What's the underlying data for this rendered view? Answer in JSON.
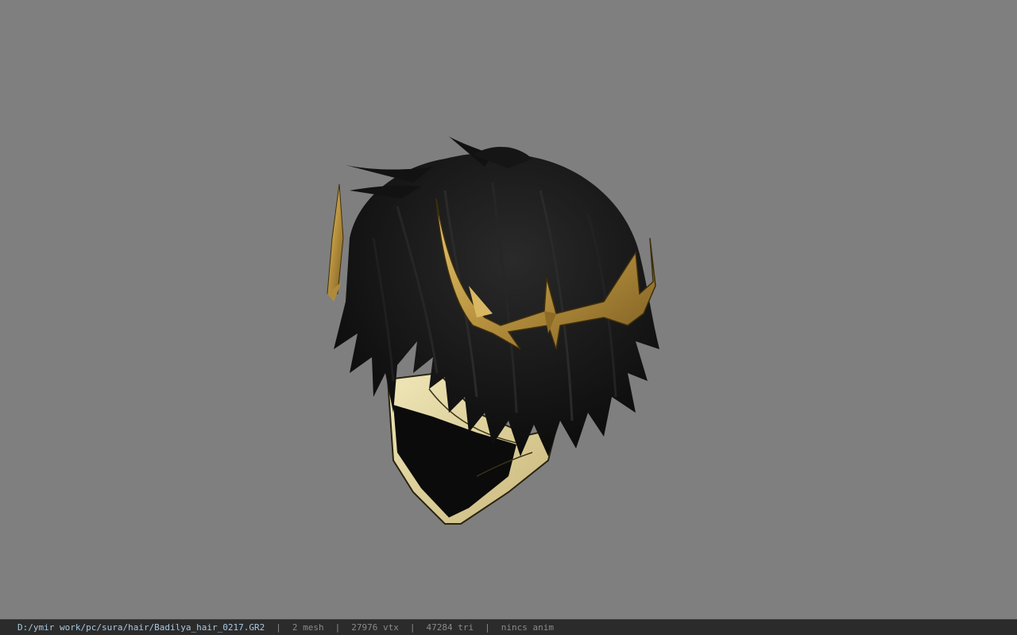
{
  "viewport": {
    "background": "#7f7f7f",
    "model_name": "hair-model-preview"
  },
  "status_bar": {
    "file_path": "D:/ymir work/pc/sura/hair/Badilya_hair_0217.GR2",
    "separator": "|",
    "mesh_count": "2 mesh",
    "vertex_count": "27976 vtx",
    "triangle_count": "47284 tri",
    "anim_status": "nincs anim"
  }
}
